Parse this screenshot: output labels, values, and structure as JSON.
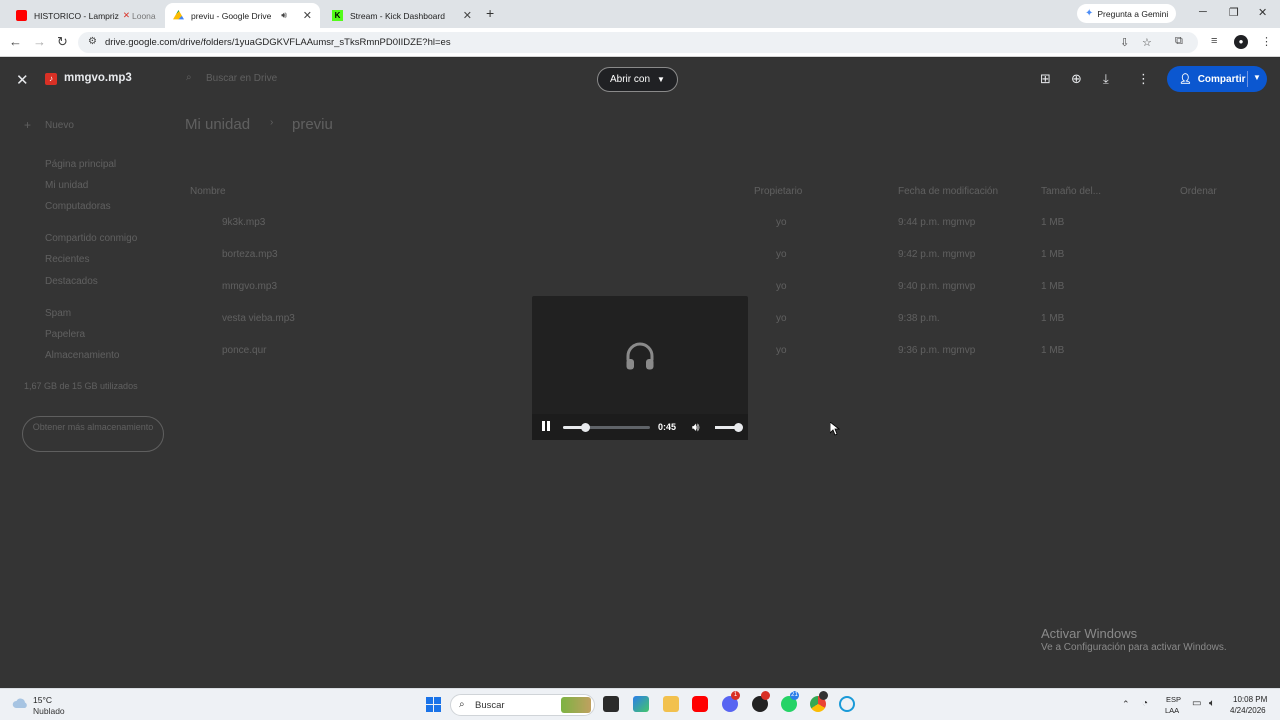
{
  "browser": {
    "tabs": [
      {
        "title": "HISTORICO - Lampriz",
        "suffix": "Loona",
        "active": false
      },
      {
        "title": "previu - Google Drive",
        "active": true
      },
      {
        "title": "Stream - Kick Dashboard",
        "active": false
      }
    ],
    "gemini_label": "Pregunta a Gemini",
    "url": "drive.google.com/drive/folders/1yuaGDGKVFLAAumsr_sTksRmnPD0IIDZE?hl=es"
  },
  "drive_background": {
    "search_placeholder": "Buscar en Drive",
    "new_label": "Nuevo",
    "breadcrumb": [
      "Mi unidad",
      "previu"
    ],
    "sidebar_items": [
      "Página principal",
      "Mi unidad",
      "Computadoras",
      "Compartido conmigo",
      "Recientes",
      "Destacados",
      "Spam",
      "Papelera",
      "Almacenamiento"
    ],
    "storage_text": "1,67 GB de 15 GB utilizados",
    "storage_button": "Obtener más almacenamiento",
    "columns": [
      "Nombre",
      "Propietario",
      "Fecha de modificación",
      "Tamaño del...",
      "Ordenar"
    ],
    "files": [
      {
        "name": "9k3k.mp3",
        "owner": "yo",
        "date": "9:44 p.m. mgmvp",
        "size": "1 MB"
      },
      {
        "name": "borteza.mp3",
        "owner": "yo",
        "date": "9:42 p.m. mgmvp",
        "size": "1 MB"
      },
      {
        "name": "mmgvo.mp3",
        "owner": "yo",
        "date": "9:40 p.m. mgmvp",
        "size": "1 MB"
      },
      {
        "name": "vesta vieba.mp3",
        "owner": "yo",
        "date": "9:38 p.m.",
        "size": "1 MB"
      },
      {
        "name": "ponce.qur",
        "owner": "yo",
        "date": "9:36 p.m. mgmvp",
        "size": "1 MB"
      }
    ]
  },
  "viewer": {
    "file_name": "mmgvo.mp3",
    "open_with": "Abrir con",
    "share_label": "Compartir"
  },
  "player": {
    "time": "0:45",
    "progress": 0.25,
    "volume": 1.0,
    "state": "playing"
  },
  "watermark": {
    "title": "Activar Windows",
    "subtitle": "Ve a Configuración para activar Windows."
  },
  "taskbar": {
    "weather_temp": "15°C",
    "weather_condition": "Nublado",
    "search_label": "Buscar",
    "discord_badge": "1",
    "whatsapp_badge": "21",
    "lang_1": "ESP",
    "lang_2": "LAA",
    "time": "10:08 PM",
    "date": "4/24/2026"
  }
}
